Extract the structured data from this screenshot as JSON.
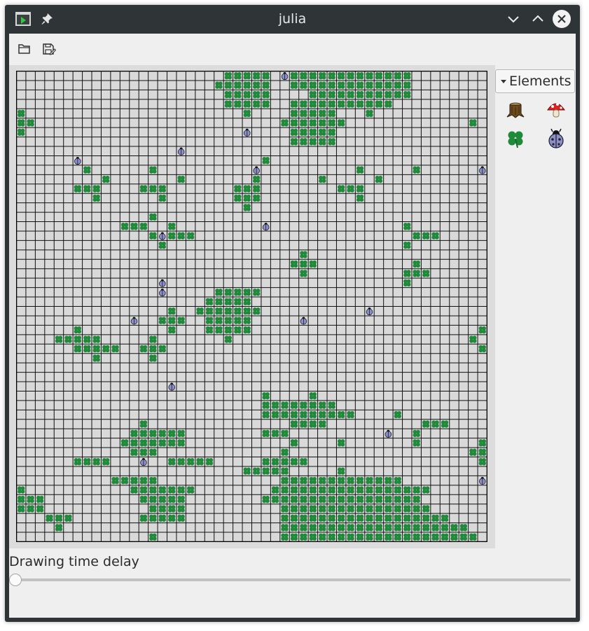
{
  "window": {
    "title": "julia",
    "icons": {
      "app": "play-icon",
      "pin": "pin-icon",
      "minimize": "chevron-down-icon",
      "maximize": "chevron-up-icon",
      "close": "close-icon"
    }
  },
  "toolbar": {
    "open_icon": "folder-open-icon",
    "save_icon": "save-icon"
  },
  "palette": {
    "header": "Elements",
    "items": [
      "tree-stump-icon",
      "mushroom-icon",
      "clover-icon",
      "ladybug-icon"
    ]
  },
  "board": {
    "cols": 50,
    "rows": 50,
    "cell_fill": "#d9d9d9",
    "grid_color": "#111111",
    "rows_map": [
      "......................SSSSS.BSSSSSSSSSSSSS........",
      ".....................SSSSSS..SSSSSSSSSSSSS........",
      "......................SSSSS....SSSSSSSSSSS........",
      "......................SSSSS..SSSSSSSSSSS..........",
      "S.......................S....SSSSS...S............",
      "SS..........................SSSSSSS.............S.",
      "S.......................B....SSSSS................",
      ".............................SSSSS................",
      ".................B...............................",
      "......B...................S.......................",
      ".......S......S..........B..........S.....S......B",
      ".........S.......S.......S......S.....S...........",
      "......SSS....SSS.......SSS........SSS.............",
      "........S......S.......SSS..........S.............",
      "........................S.........................",
      "..............S...................................",
      "...........SSS..S.........B..............S........",
      "..............SBSSS.......................SSS......",
      "...............S.........................S........",
      "..............................S...................",
      ".............................SSS..........S.......",
      "..............................S..........SSS......",
      "...............B.........................S........",
      "...............B.....SSSSS........................",
      "....................SSSSS.........................",
      "................S..SSSSSSS...........B............",
      "............B..SSS..SSSSS.....B...................",
      "......S.........S...SSSSS........................S",
      "....SSSSS.....S.......S.........................S.",
      "......SSSSS..SSS.................................S",
      "........S.....S...................................",
      "..................................................",
      "..................................................",
      "................B.................................",
      "..........................S....S..................",
      "..........................SSSSSSSS................",
      "..........................SSSSSSSSSS....S.........",
      ".............S...............SSSS..........SSS....",
      "............SSSSSS........SSS..........B..S.......",
      "...........SSSSSSS...........S....S.......S......S",
      "............SSS.............S...................SS",
      "......SSSS...B..SSSSS.....SSSSS..................S",
      "........................SSSSS.....S...............",
      "..........SSSSS.............SSSSSSSSSSSSS........B",
      "S...........SSSSSSS........SSSSSSSSSSSSSSSSS......",
      "SSS..........SSSSS........SSSSSSSSSSSSSSSSS.......",
      "SSS...........SSSS..........SSSSSSSSSSSSSSSS......",
      "...SSS.......SSSSS..........SSSSSSSSSSSSSSSSSS....",
      "....S.......................SSSSSSSSSSSSSSSSSSSS..",
      "..............S.............SSSSSSSSSSSSSSSSSSSSS.",
      "...........SSSS.........SSSSSSSSSSSSSSSSSSSSSSSS..",
      "..............S.............SSSSSSSSSSSSBSSSSSSS..",
      ".........................S...SSSSSSSSSSSSSSSSSS...",
      ".............B.....SSSSS....SSSSSSSSSSSSSSS......."
    ],
    "legend": {
      "S": "clover",
      "B": "ladybug",
      ".": "empty"
    }
  },
  "delay": {
    "label": "Drawing time delay",
    "value": 0
  }
}
